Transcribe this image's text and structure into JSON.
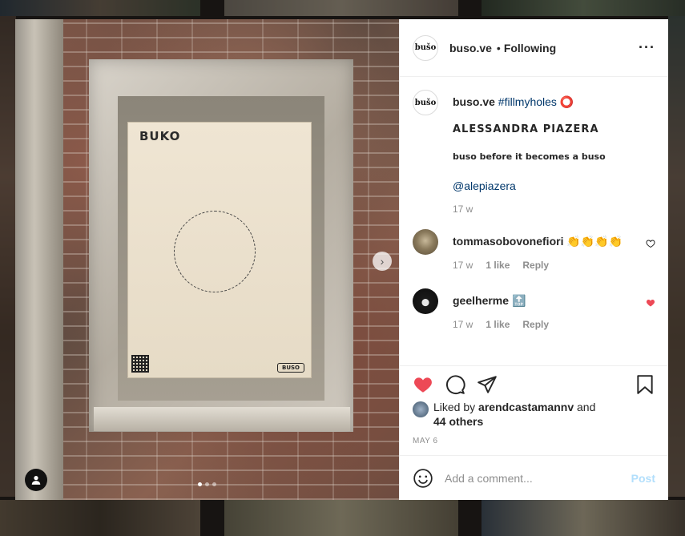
{
  "post": {
    "username": "buso.ve",
    "avatar_text": "bušo",
    "follow_status": "Following",
    "separator": "•",
    "more_icon": "more-horizontal-icon"
  },
  "media": {
    "panel_title": "BUKO",
    "panel_logo": "BUSO",
    "next_icon": "chevron-right-icon",
    "user_tag_icon": "user-icon",
    "slide_count": 3,
    "active_slide": 1
  },
  "caption": {
    "username": "buso.ve",
    "hashtag": "#fillmyholes",
    "emoji": "⭕",
    "name": "ALESSANDRA PIAZERA",
    "subtitle": "buso before it becomes a buso",
    "mention": "@alepiazera",
    "time": "17 w"
  },
  "comments": [
    {
      "username": "tommasobovonefiori",
      "text": "👏👏👏👏",
      "time": "17 w",
      "likes": "1 like",
      "reply": "Reply",
      "liked": false
    },
    {
      "username": "geelherme",
      "text": "🔝",
      "time": "17 w",
      "likes": "1 like",
      "reply": "Reply",
      "liked": true
    }
  ],
  "actions": {
    "liked_by_prefix": "Liked by",
    "liked_by_user": "arendcastamannv",
    "liked_by_and": "and",
    "liked_by_others": "44 others",
    "date": "MAY 6"
  },
  "add_comment": {
    "placeholder": "Add a comment...",
    "post_label": "Post"
  },
  "colors": {
    "like_red": "#ed4956",
    "link_blue": "#00376b",
    "post_disabled": "#b2dffc"
  }
}
